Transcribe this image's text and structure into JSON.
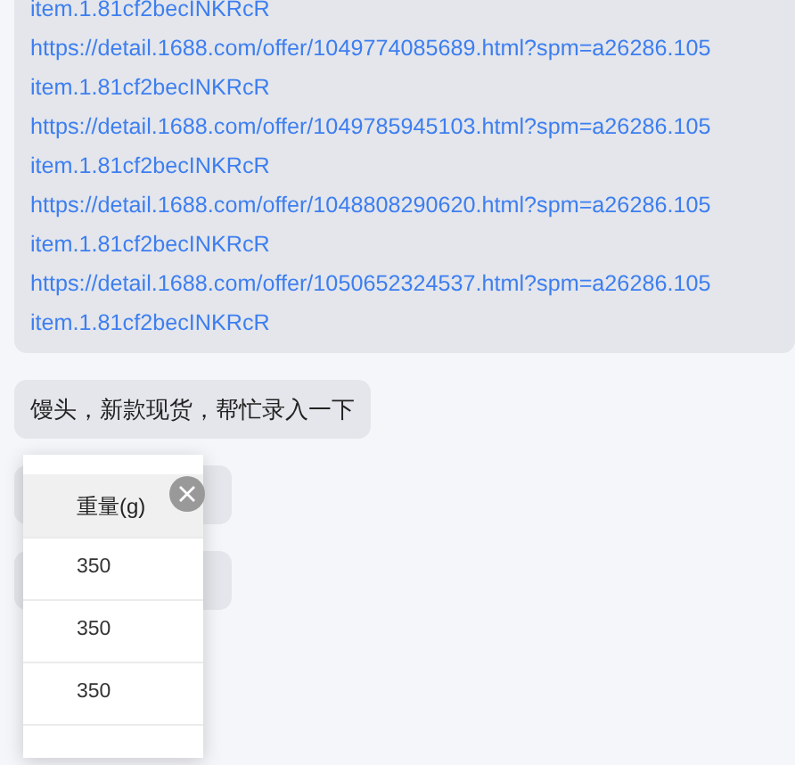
{
  "messages": [
    {
      "kind": "links",
      "lines": [
        "item.1.81cf2becINKRcR",
        "https://detail.1688.com/offer/1049774085689.html?spm=a26286.105",
        "item.1.81cf2becINKRcR",
        "https://detail.1688.com/offer/1049785945103.html?spm=a26286.105",
        "item.1.81cf2becINKRcR",
        "https://detail.1688.com/offer/1048808290620.html?spm=a26286.105",
        "item.1.81cf2becINKRcR",
        "https://detail.1688.com/offer/1050652324537.html?spm=a26286.105",
        "item.1.81cf2becINKRcR"
      ]
    },
    {
      "kind": "text",
      "text": "馒头，新款现货，帮忙录入一下"
    },
    {
      "kind": "hidden"
    },
    {
      "kind": "hidden"
    }
  ],
  "popup_table": {
    "header": "重量(g)",
    "rows": [
      "350",
      "350",
      "350"
    ]
  }
}
